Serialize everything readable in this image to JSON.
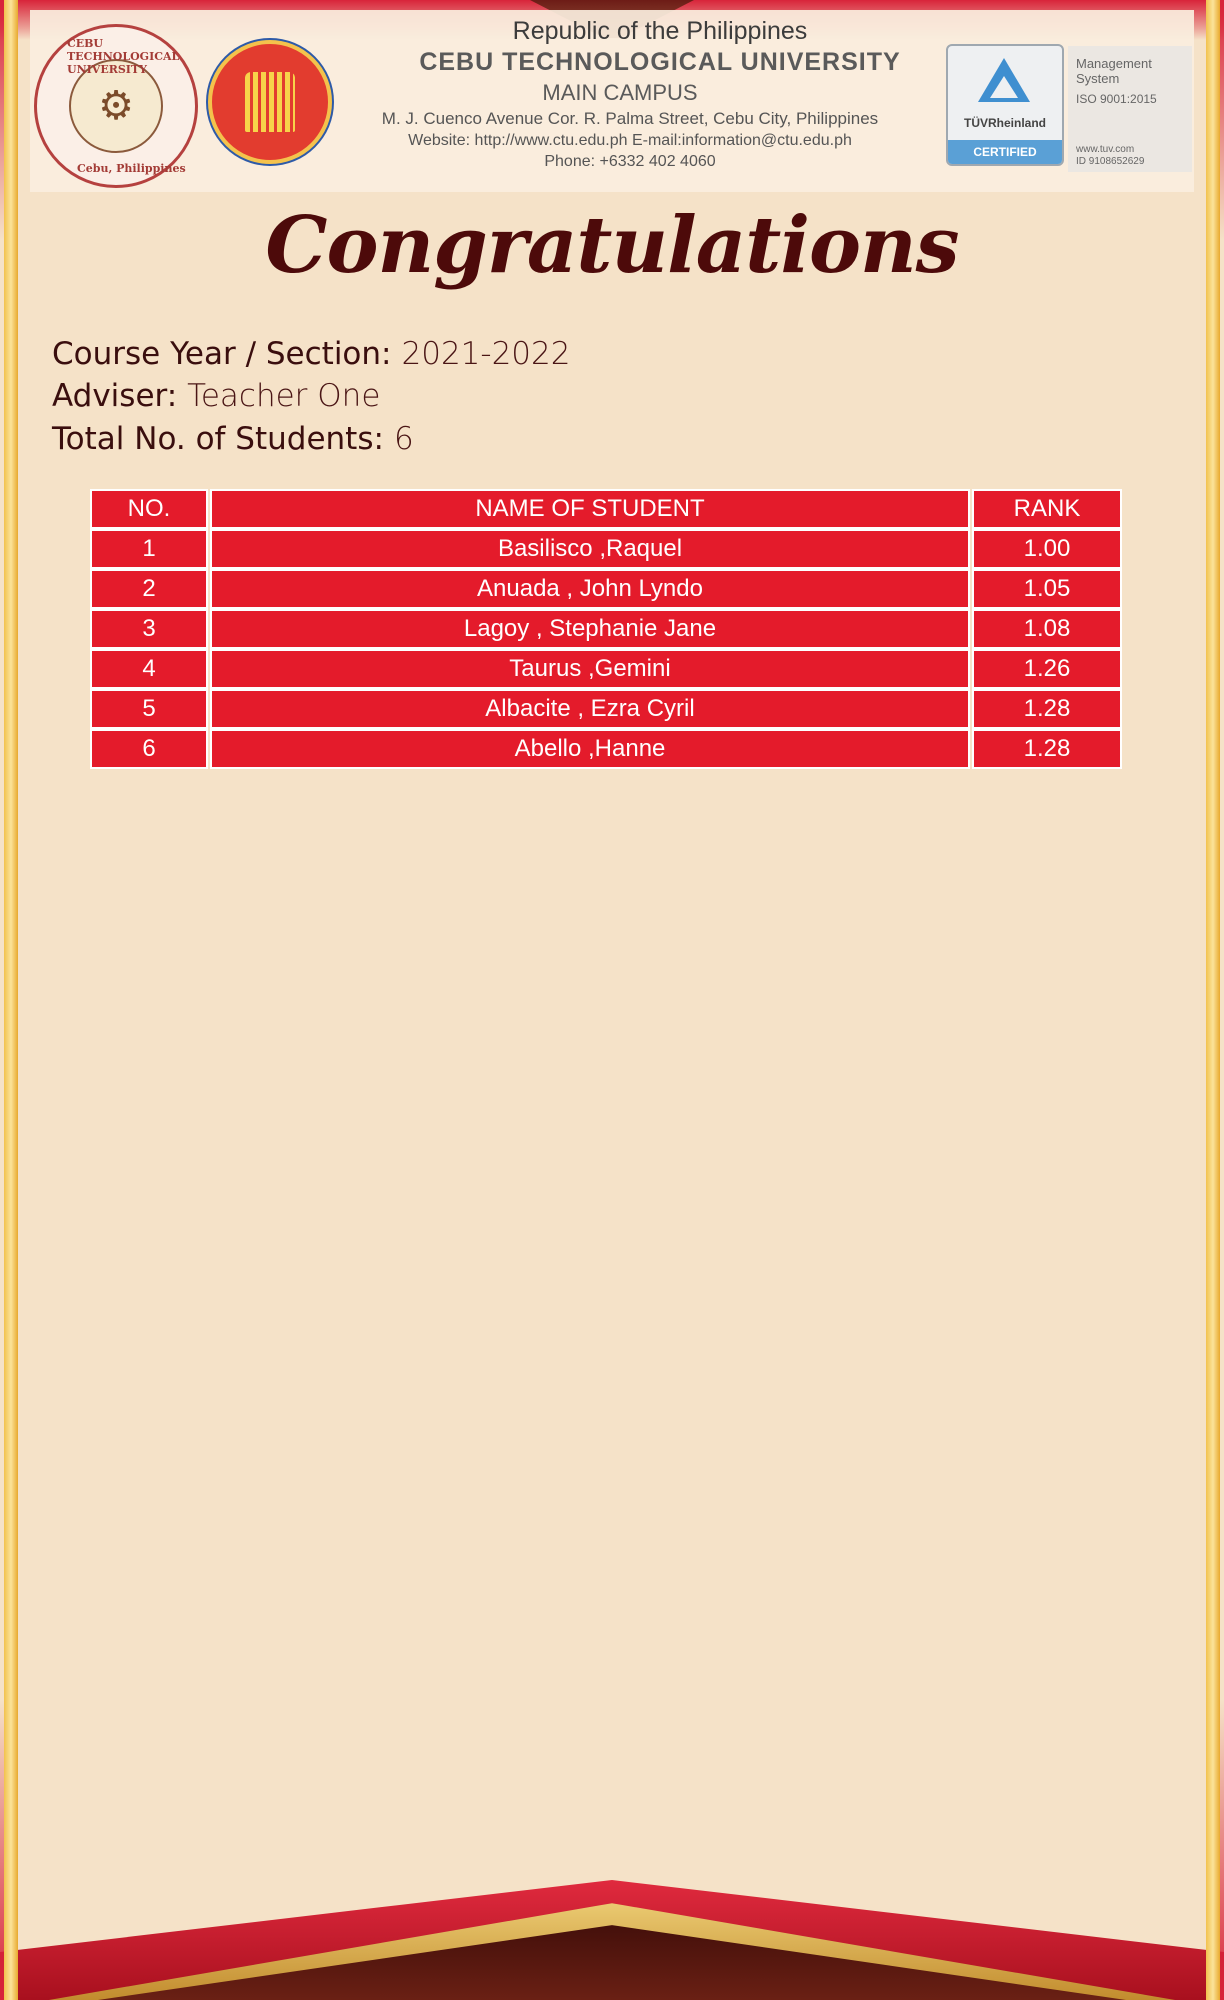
{
  "header": {
    "republic": "Republic of the Philippines",
    "university": "CEBU TECHNOLOGICAL UNIVERSITY",
    "campus": "MAIN CAMPUS",
    "address": "M. J. Cuenco Avenue Cor. R. Palma Street, Cebu City, Philippines",
    "web_email": "Website: http://www.ctu.edu.ph E-mail:information@ctu.edu.ph",
    "phone": "Phone: +6332 402 4060",
    "seal_ring_top": "CEBU TECHNOLOGICAL UNIVERSITY",
    "seal_ring_bottom": "Cebu, Philippines",
    "tuv_name": "TÜVRheinland",
    "tuv_certified": "CERTIFIED",
    "mgmt_system": "Management System",
    "iso": "ISO 9001:2015",
    "tuv_site": "www.tuv.com",
    "tuv_id": "ID 9108652629"
  },
  "title": "Congratulations",
  "info": {
    "course_label": "Course Year / Section:",
    "course_value": "2021-2022",
    "adviser_label": "Adviser:",
    "adviser_value": "Teacher One",
    "total_label": "Total No. of Students:",
    "total_value": "6"
  },
  "table": {
    "headers": [
      "NO.",
      "NAME OF STUDENT",
      "RANK"
    ],
    "rows": [
      {
        "no": "1",
        "name": "Basilisco ,Raquel",
        "rank": "1.00"
      },
      {
        "no": "2",
        "name": "Anuada , John Lyndo",
        "rank": "1.05"
      },
      {
        "no": "3",
        "name": "Lagoy , Stephanie Jane",
        "rank": "1.08"
      },
      {
        "no": "4",
        "name": "Taurus ,Gemini",
        "rank": "1.26"
      },
      {
        "no": "5",
        "name": "Albacite , Ezra Cyril",
        "rank": "1.28"
      },
      {
        "no": "6",
        "name": "Abello ,Hanne",
        "rank": "1.28"
      }
    ]
  },
  "colors": {
    "background": "#f5e2c8",
    "table_red": "#e41b2b",
    "title": "#4d0a0a"
  }
}
